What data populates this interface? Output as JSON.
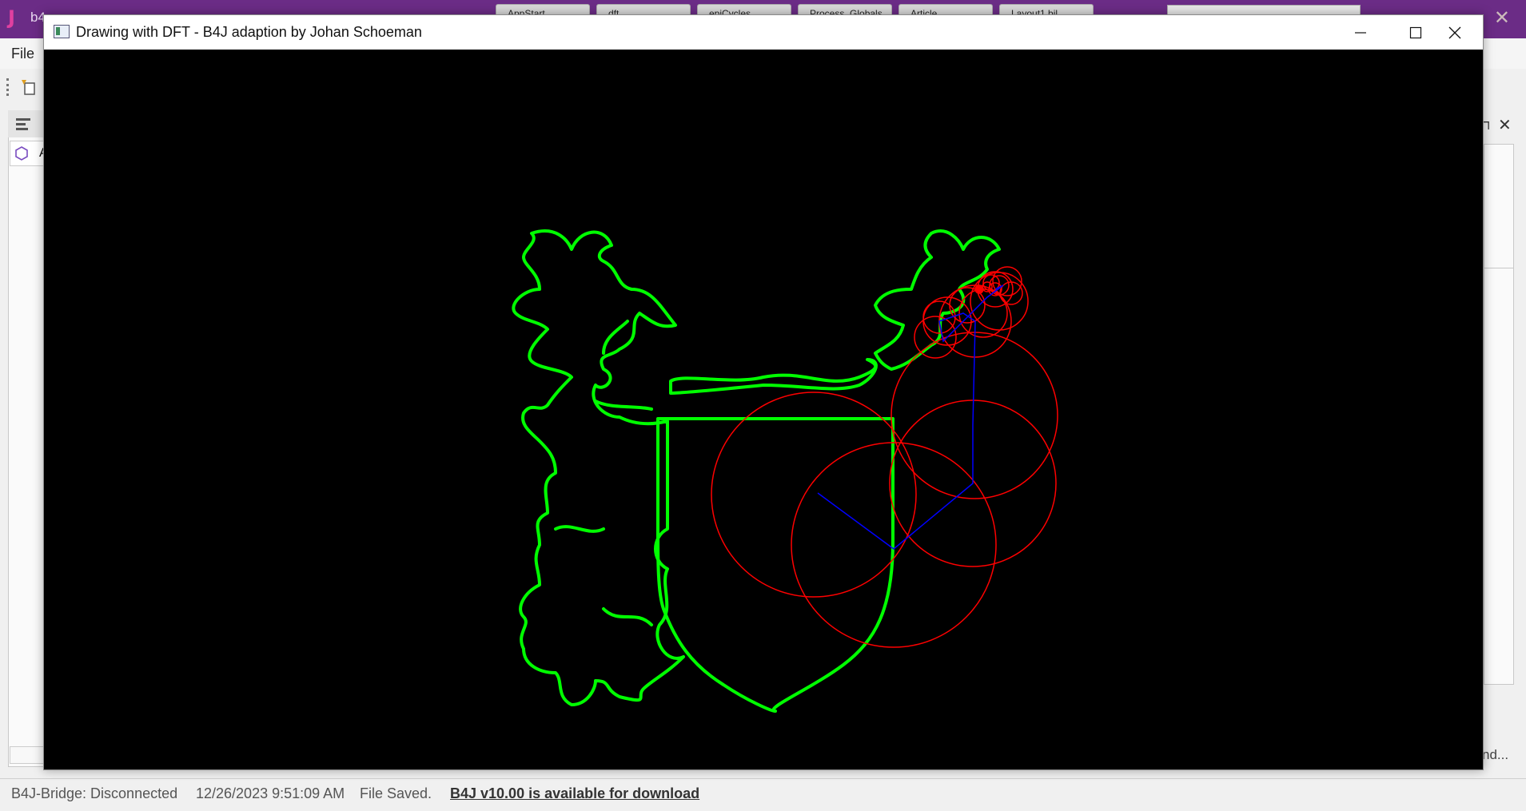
{
  "background_ide": {
    "logo": "J",
    "title_fragment": "b4",
    "tabs": [
      "AppStart",
      "dft",
      "epiCycles",
      "Process_Globals",
      "Article",
      "Layout1.bjl"
    ],
    "menu_file": "File",
    "panel_item_label": "A",
    "right_hint": "nd...",
    "status": {
      "bridge": "B4J-Bridge: Disconnected",
      "datetime": "12/26/2023 9:51:09 AM",
      "file_state": "File Saved.",
      "update_link": "B4J v10.00 is available for download"
    }
  },
  "window": {
    "title": "Drawing with DFT - B4J adaption by Johan Schoeman",
    "controls": {
      "minimize": "minimize-icon",
      "maximize": "maximize-icon",
      "close": "close-icon"
    }
  },
  "drawing": {
    "background_color": "#000000",
    "outline_color": "#00ff00",
    "epicycle_circle_color": "#ff0000",
    "radius_line_color": "#0000ff"
  }
}
